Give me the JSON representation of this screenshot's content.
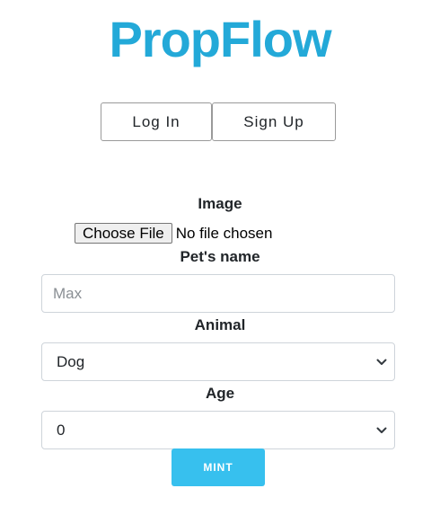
{
  "header": {
    "brand": "PropFlow",
    "brand_color": "#23a9d8"
  },
  "auth": {
    "login_label": "Log In",
    "signup_label": "Sign Up"
  },
  "form": {
    "image_label": "Image",
    "file_button_label": "Choose File",
    "file_status": "No file chosen",
    "pet_name_label": "Pet's name",
    "pet_name_placeholder": "Max",
    "pet_name_value": "",
    "animal_label": "Animal",
    "animal_selected": "Dog",
    "age_label": "Age",
    "age_selected": "0",
    "mint_label": "MINT",
    "mint_color": "#37c0ee"
  },
  "icons": {
    "select_chevron": "chevron-down-icon"
  }
}
